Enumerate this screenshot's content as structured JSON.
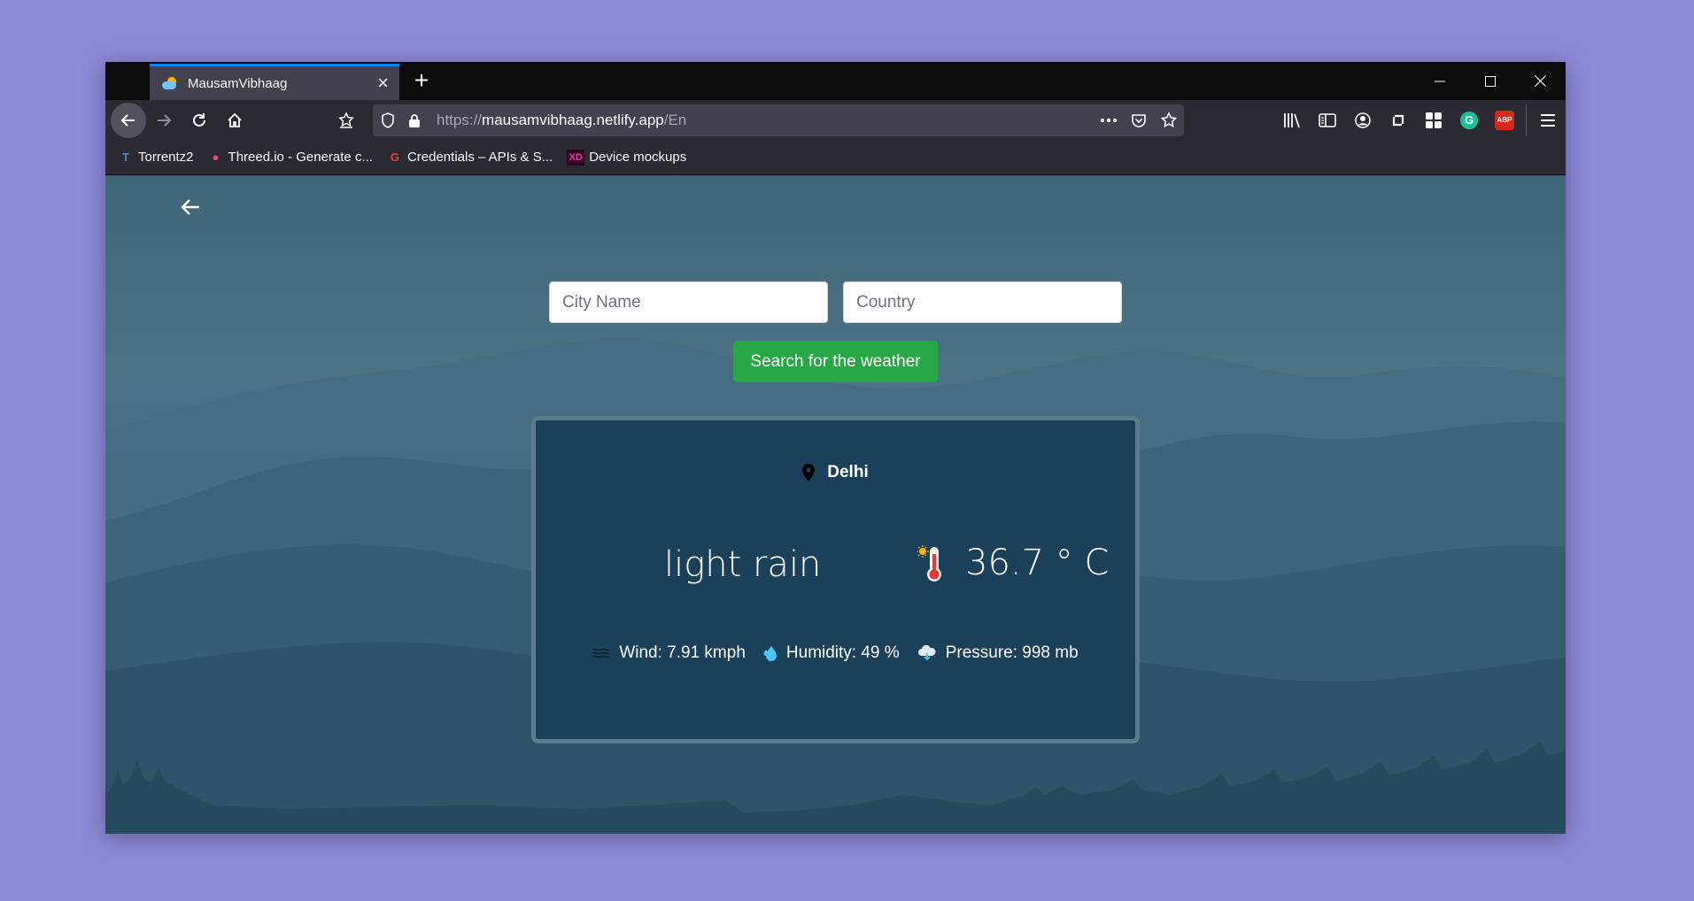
{
  "browser": {
    "tab": {
      "title": "MausamVibhaag"
    },
    "url": {
      "protocol": "https://",
      "host": "mausamvibhaag.netlify.app",
      "path": "/En"
    },
    "bookmarks": [
      {
        "label": "Torrentz2",
        "icon": "T",
        "color": "#4b8bd6"
      },
      {
        "label": "Threed.io - Generate c...",
        "icon": "●",
        "color": "#e84b6c"
      },
      {
        "label": "Credentials – APIs & S...",
        "icon": "G",
        "color": "#ea4335"
      },
      {
        "label": "Device mockups",
        "icon": "XD",
        "color": "#ff2bc2"
      }
    ],
    "extensions": {
      "abp": "ABP",
      "grammarly": "G"
    }
  },
  "app": {
    "city_placeholder": "City Name",
    "country_placeholder": "Country",
    "search_label": "Search for the weather",
    "weather": {
      "city": "Delhi",
      "condition": "light rain",
      "temperature": "36.7 ° C",
      "wind": "Wind: 7.91 kmph",
      "humidity": "Humidity: 49 %",
      "pressure": "Pressure: 998 mb"
    }
  },
  "colors": {
    "accent": "#0a84ff",
    "search_button": "#28a745",
    "card_bg": "#1a4159"
  }
}
